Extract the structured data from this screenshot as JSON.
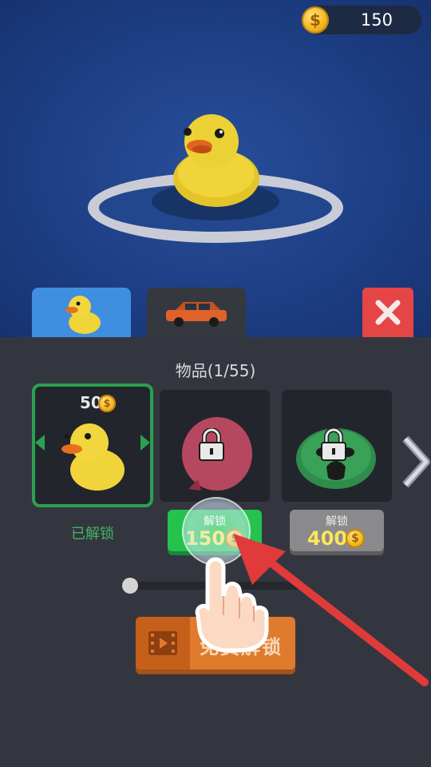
{
  "hud": {
    "coins": "150",
    "coin_symbol": "$"
  },
  "tabs": [
    {
      "name": "duck",
      "active": true
    },
    {
      "name": "car",
      "active": false
    }
  ],
  "panel": {
    "title": "物品(1/55)"
  },
  "items": [
    {
      "price": "50",
      "status_label": "已解锁",
      "locked": false
    },
    {
      "unlock_small": "解锁",
      "unlock_price": "150",
      "locked": true
    },
    {
      "unlock_small": "解锁",
      "unlock_price": "400",
      "locked": true
    }
  ],
  "ad_button": {
    "label": "免费解锁"
  },
  "colors": {
    "accent_green": "#25c24e",
    "close_red": "#e54545",
    "ad_orange": "#e07a2c",
    "tab_blue": "#3f8ee0"
  }
}
